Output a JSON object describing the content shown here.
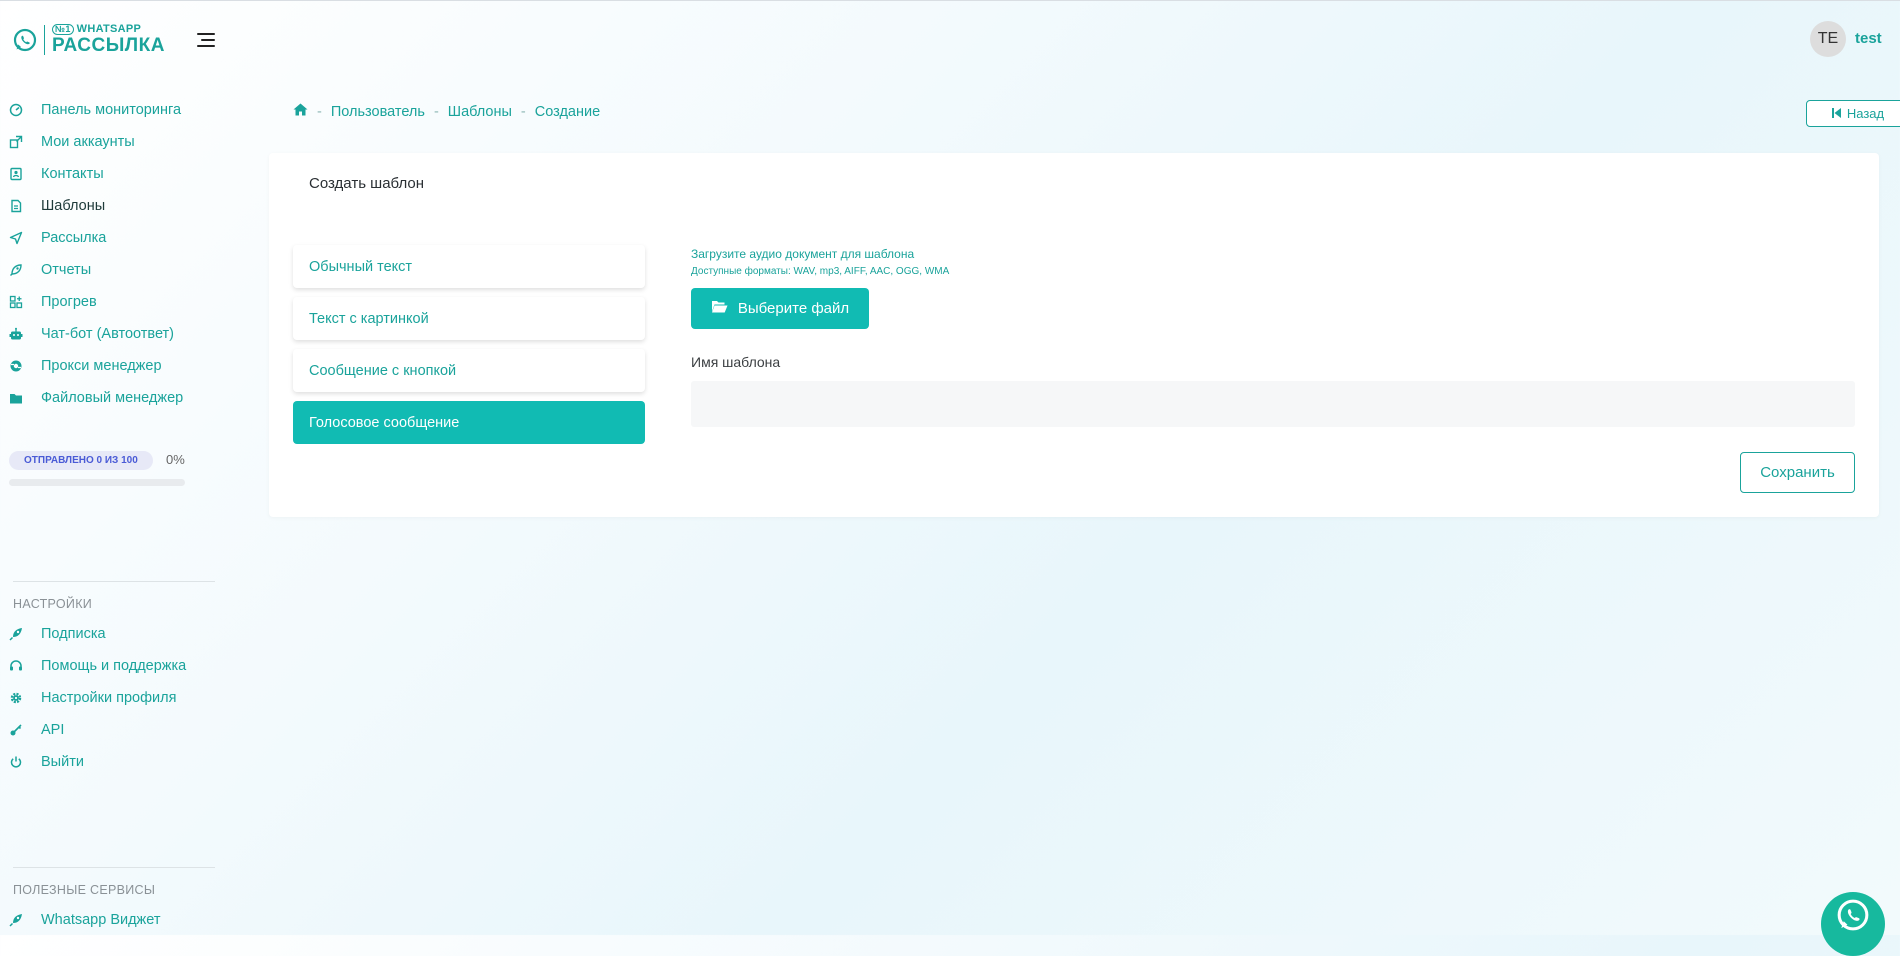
{
  "brand": {
    "line1_badge": "№1",
    "line1": "WHATSAPP",
    "line2": "РАССЫЛКА",
    "accent": "#1aa39b",
    "active_tab_color": "#11bbb3"
  },
  "sidebar": {
    "items": [
      {
        "label": "Панель мониторинга",
        "icon": "dashboard-icon"
      },
      {
        "label": "Мои аккаунты",
        "icon": "accounts-icon"
      },
      {
        "label": "Контакты",
        "icon": "contacts-icon"
      },
      {
        "label": "Шаблоны",
        "icon": "templates-icon"
      },
      {
        "label": "Рассылка",
        "icon": "send-icon"
      },
      {
        "label": "Отчеты",
        "icon": "reports-icon"
      },
      {
        "label": "Прогрев",
        "icon": "warmup-icon"
      },
      {
        "label": "Чат-бот (Автоответ)",
        "icon": "bot-icon"
      },
      {
        "label": "Прокси менеджер",
        "icon": "proxy-icon"
      },
      {
        "label": "Файловый менеджер",
        "icon": "folder-icon"
      }
    ],
    "sent": {
      "label": "ОТПРАВЛЕНО 0 ИЗ 100",
      "percent": "0%",
      "progress": 0
    },
    "settings_title": "НАСТРОЙКИ",
    "settings_items": [
      {
        "label": "Подписка",
        "icon": "rocket-icon"
      },
      {
        "label": "Помощь и поддержка",
        "icon": "headset-icon"
      },
      {
        "label": "Настройки профиля",
        "icon": "gear-icon"
      },
      {
        "label": "API",
        "icon": "key-icon"
      },
      {
        "label": "Выйти",
        "icon": "power-icon"
      }
    ],
    "services_title": "ПОЛЕЗНЫЕ СЕРВИСЫ",
    "services_items": [
      {
        "label": "Whatsapp Виджет",
        "icon": "rocket-icon"
      }
    ]
  },
  "user": {
    "initials": "TE",
    "name": "test"
  },
  "breadcrumb": {
    "items": [
      "Пользователь",
      "Шаблоны",
      "Создание"
    ]
  },
  "back_button": "Назад",
  "card": {
    "title": "Создать шаблон",
    "tabs": [
      {
        "label": "Обычный текст",
        "active": false
      },
      {
        "label": "Текст с картинкой",
        "active": false
      },
      {
        "label": "Сообщение с кнопкой",
        "active": false
      },
      {
        "label": "Голосовое сообщение",
        "active": true
      }
    ],
    "upload_label": "Загрузите аудио документ для шаблона",
    "formats": "Доступные форматы: WAV, mp3, AIFF, AAC, OGG, WMA",
    "file_button": "Выберите файл",
    "name_label": "Имя шаблона",
    "name_value": "",
    "save_button": "Сохранить"
  }
}
